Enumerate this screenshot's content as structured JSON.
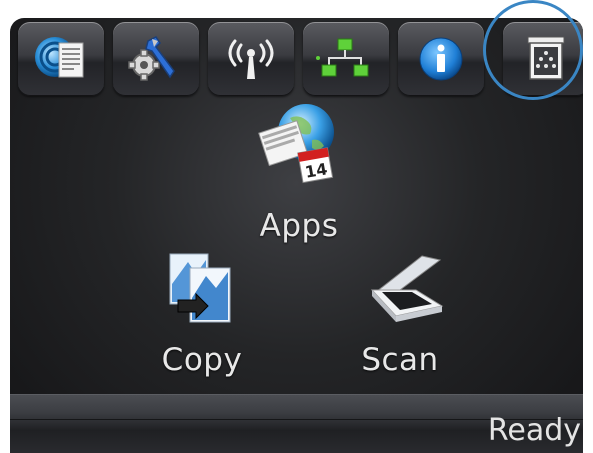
{
  "toolbar": {
    "buttons": [
      {
        "icon": "web-services-icon"
      },
      {
        "icon": "setup-icon"
      },
      {
        "icon": "wireless-icon"
      },
      {
        "icon": "network-icon"
      },
      {
        "icon": "information-icon"
      },
      {
        "icon": "supplies-icon"
      }
    ],
    "highlighted": "supplies-icon"
  },
  "apps": {
    "apps_label": "Apps",
    "copy_label": "Copy",
    "scan_label": "Scan",
    "calendar_number": "14"
  },
  "status": {
    "text": "Ready"
  },
  "colors": {
    "highlight_ring": "#3a86c4",
    "info_blue": "#1f7fd6",
    "network_green": "#5fd13a"
  }
}
